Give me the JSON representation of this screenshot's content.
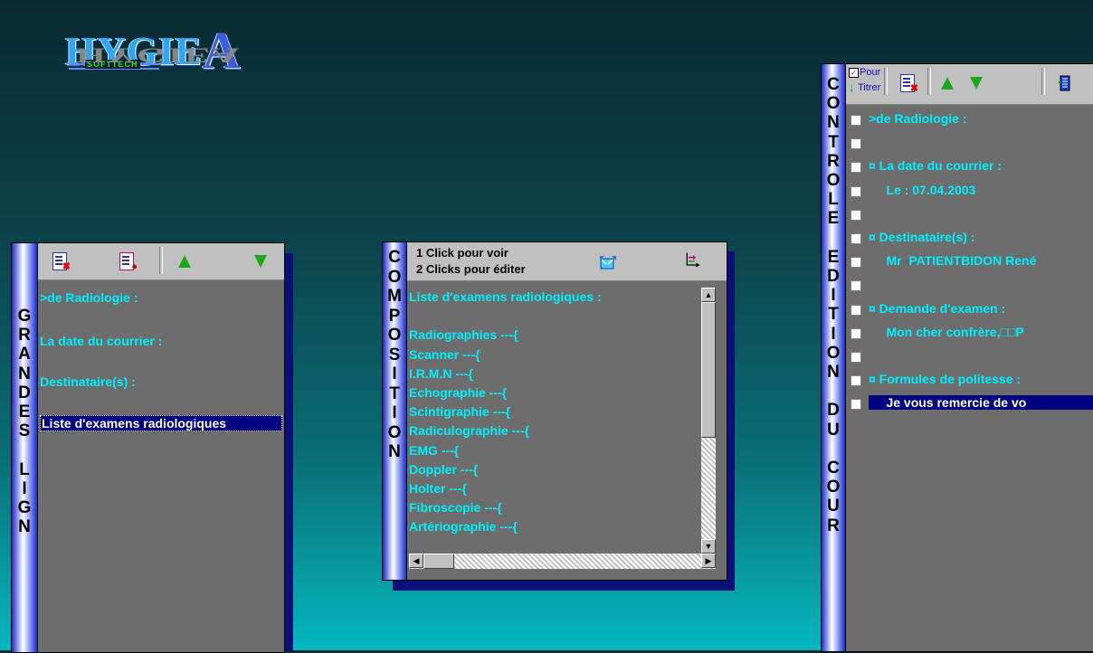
{
  "logo": {
    "text": "HYGIE",
    "last_letter": "A",
    "sub": "SOFTTECH",
    "reflection": "HYGIEA"
  },
  "left_panel": {
    "vertical_label": [
      "G",
      "R",
      "A",
      "N",
      "D",
      "E",
      "S",
      "",
      "L",
      "I",
      "G",
      "N"
    ],
    "items": [
      ">de Radiologie :",
      "La date du courrier :",
      "Destinataire(s) :",
      "Liste d'examens radiologiques"
    ],
    "selected_index": 3
  },
  "middle_panel": {
    "vertical_label": [
      "C",
      "O",
      "M",
      "P",
      "O",
      "S",
      "I",
      "T",
      "I",
      "O",
      "N"
    ],
    "hint_line1": "1 Click pour voir",
    "hint_line2": "2 Clicks pour éditer",
    "items": [
      "Liste d'examens radiologiques :",
      "",
      "Radiographies ---{",
      "Scanner ---{",
      "I.R.M.N ---{",
      "Echographie ---{",
      "Scintigraphie ---{",
      "Radiculographie ---{",
      "EMG ---{",
      "Doppler ---{",
      "Holter ---{",
      "Fibroscopie ---{",
      "Artériographie ---{"
    ]
  },
  "right_panel": {
    "vertical_label": [
      "C",
      "O",
      "N",
      "T",
      "R",
      "O",
      "L",
      "E",
      "",
      "E",
      "D",
      "I",
      "T",
      "I",
      "O",
      "N",
      "",
      "D",
      "U",
      "",
      "C",
      "O",
      "U",
      "R"
    ],
    "titrer_label_1": "Pour",
    "titrer_label_2": "Titrer",
    "rows": [
      ">de Radiologie :",
      "",
      "¤ La date du courrier :",
      "     Le : 07.04.2003",
      "",
      "¤ Destinataire(s) :",
      "     Mr  PATIENTBIDON René",
      "",
      "¤ Demande d'examen :",
      "     Mon cher confrère,□□P",
      "",
      "¤ Formules de politesse :",
      "     Je vous remercie de vo"
    ],
    "selected_index": 12
  }
}
